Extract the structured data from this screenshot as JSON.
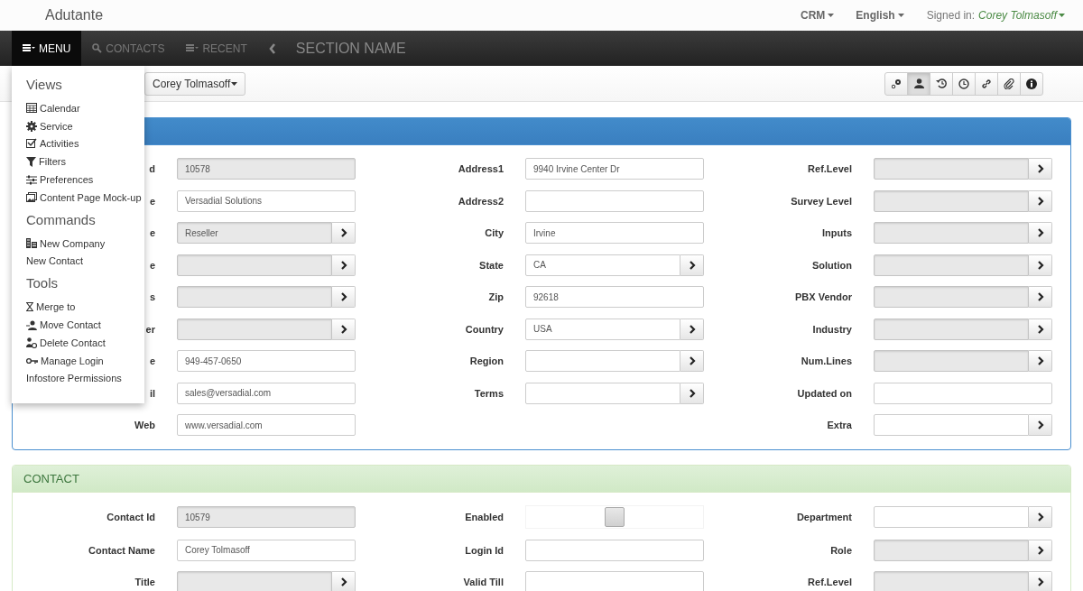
{
  "header": {
    "brand": "Adutante",
    "menus": [
      {
        "label": "CRM"
      },
      {
        "label": "English"
      }
    ],
    "signed_in_label": "Signed in:",
    "user": "Corey Tolmasoff"
  },
  "nav": {
    "items": [
      {
        "label": "MENU",
        "selected": true
      },
      {
        "label": "CONTACTS",
        "selected": false
      },
      {
        "label": "RECENT",
        "selected": false
      }
    ],
    "section_name": "SECTION NAME"
  },
  "toolbar": {
    "record_button": "Corey Tolmasoff",
    "buttons": [
      {
        "selected": false
      },
      {
        "selected": true
      },
      {
        "selected": false
      },
      {
        "selected": false
      },
      {
        "selected": false
      },
      {
        "selected": false
      },
      {
        "selected": false
      }
    ]
  },
  "menu": {
    "sections": [
      {
        "title": "Views",
        "items": [
          "Calendar",
          "Service",
          "Activities",
          "Filters",
          "Preferences",
          "Content Page Mock-up"
        ]
      },
      {
        "title": "Commands",
        "items": [
          "New Company",
          "New Contact"
        ]
      },
      {
        "title": "Tools",
        "items": [
          "Merge to",
          "Move Contact",
          "Delete Contact",
          "Manage Login",
          "Infostore Permissions"
        ]
      }
    ]
  },
  "panels": [
    {
      "kind": "primary",
      "rows": [
        {
          "cells": [
            {
              "label": "d",
              "kind": "text",
              "value": "10578",
              "disabled": true
            },
            {
              "label": "Address1",
              "kind": "text",
              "value": "9940 Irvine Center Dr",
              "disabled": false
            },
            {
              "label": "Ref.Level",
              "kind": "lookup",
              "disabled": true
            }
          ]
        },
        {
          "cells": [
            {
              "label": "e",
              "kind": "text",
              "value": "Versadial Solutions",
              "disabled": false
            },
            {
              "label": "Address2",
              "kind": "text",
              "disabled": false
            },
            {
              "label": "Survey Level",
              "kind": "lookup",
              "disabled": true
            }
          ]
        },
        {
          "cells": [
            {
              "label": "e",
              "kind": "lookup",
              "value": "Reseller",
              "disabled": true
            },
            {
              "label": "City",
              "kind": "text",
              "value": "Irvine",
              "disabled": false
            },
            {
              "label": "Inputs",
              "kind": "lookup",
              "disabled": true
            }
          ]
        },
        {
          "cells": [
            {
              "label": "e",
              "kind": "lookup",
              "disabled": true
            },
            {
              "label": "State",
              "kind": "lookup",
              "value": "CA",
              "disabled": false
            },
            {
              "label": "Solution",
              "kind": "lookup",
              "disabled": true
            }
          ]
        },
        {
          "cells": [
            {
              "label": "s",
              "kind": "lookup",
              "disabled": true
            },
            {
              "label": "Zip",
              "kind": "text",
              "value": "92618",
              "disabled": false
            },
            {
              "label": "PBX Vendor",
              "kind": "lookup",
              "disabled": true
            }
          ]
        },
        {
          "cells": [
            {
              "label": "er",
              "kind": "lookup",
              "disabled": true
            },
            {
              "label": "Country",
              "kind": "lookup",
              "value": "USA",
              "disabled": false
            },
            {
              "label": "Industry",
              "kind": "lookup",
              "disabled": true
            }
          ]
        },
        {
          "cells": [
            {
              "label": "e",
              "kind": "text",
              "value": "949-457-0650",
              "disabled": false
            },
            {
              "label": "Region",
              "kind": "lookup",
              "disabled": false
            },
            {
              "label": "Num.Lines",
              "kind": "lookup",
              "disabled": true
            }
          ]
        },
        {
          "cells": [
            {
              "label": "il",
              "kind": "text",
              "value": "sales@versadial.com",
              "disabled": false
            },
            {
              "label": "Terms",
              "kind": "lookup",
              "disabled": false
            },
            {
              "label": "Updated on",
              "kind": "text",
              "disabled": false
            }
          ]
        },
        {
          "cells": [
            {
              "label": "Web",
              "kind": "text",
              "value": "www.versadial.com",
              "disabled": false
            },
            null,
            {
              "label": "Extra",
              "kind": "lookup",
              "disabled": false
            }
          ]
        }
      ]
    },
    {
      "kind": "success",
      "title": "CONTACT",
      "rows": [
        {
          "cells": [
            {
              "label": "Contact Id",
              "kind": "text",
              "value": "10579",
              "disabled": true
            },
            {
              "label": "Enabled",
              "kind": "checkbox",
              "checked": false
            },
            {
              "label": "Department",
              "kind": "lookup",
              "disabled": false
            }
          ]
        },
        {
          "cells": [
            {
              "label": "Contact Name",
              "kind": "text",
              "value": "Corey Tolmasoff",
              "disabled": false
            },
            {
              "label": "Login Id",
              "kind": "text",
              "disabled": false
            },
            {
              "label": "Role",
              "kind": "lookup",
              "disabled": true
            }
          ]
        },
        {
          "cells": [
            {
              "label": "Title",
              "kind": "lookup",
              "disabled": true
            },
            {
              "label": "Valid Till",
              "kind": "text",
              "disabled": false
            },
            {
              "label": "Ref.Level",
              "kind": "lookup",
              "disabled": true
            }
          ]
        }
      ]
    }
  ]
}
